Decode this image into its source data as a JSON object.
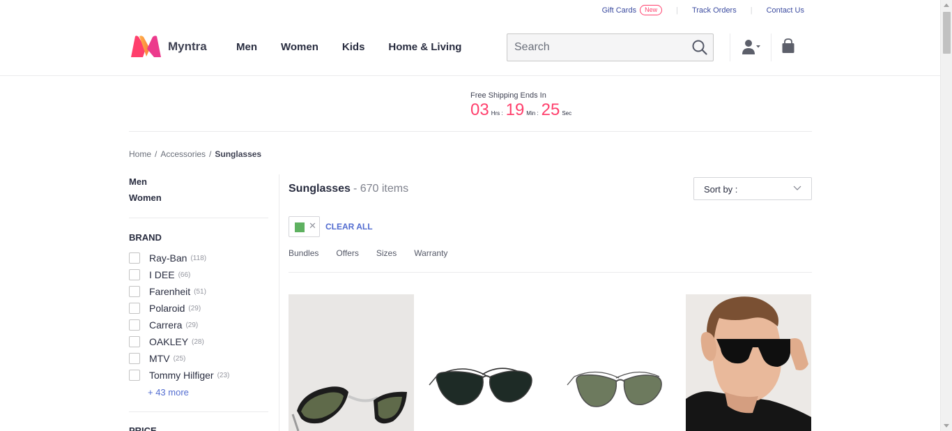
{
  "toplinks": {
    "gift_cards": "Gift Cards",
    "new_badge": "New",
    "track_orders": "Track Orders",
    "contact_us": "Contact Us"
  },
  "brand": {
    "name": "Myntra"
  },
  "nav": [
    "Men",
    "Women",
    "Kids",
    "Home & Living"
  ],
  "search": {
    "placeholder": "Search"
  },
  "banner": {
    "title": "Free Shipping Ends In",
    "hours": "03",
    "hours_unit": "Hrs :",
    "minutes": "19",
    "minutes_unit": "Min :",
    "seconds": "25",
    "seconds_unit": "Sec"
  },
  "breadcrumb": {
    "home": "Home",
    "sep": "/",
    "category": "Accessories",
    "current": "Sunglasses"
  },
  "sidebar": {
    "genders": [
      "Men",
      "Women"
    ],
    "brand_title": "BRAND",
    "brands": [
      {
        "name": "Ray-Ban",
        "count": "(118)"
      },
      {
        "name": "I DEE",
        "count": "(66)"
      },
      {
        "name": "Farenheit",
        "count": "(51)"
      },
      {
        "name": "Polaroid",
        "count": "(29)"
      },
      {
        "name": "Carrera",
        "count": "(29)"
      },
      {
        "name": "OAKLEY",
        "count": "(28)"
      },
      {
        "name": "MTV",
        "count": "(25)"
      },
      {
        "name": "Tommy Hilfiger",
        "count": "(23)"
      }
    ],
    "more": "+ 43 more",
    "price_title": "PRICE"
  },
  "main": {
    "title": "Sunglasses",
    "count": "- 670 items",
    "sort_label": "Sort by :",
    "clear_all": "CLEAR ALL",
    "filters": [
      "Bundles",
      "Offers",
      "Sizes",
      "Warranty"
    ]
  },
  "colors": {
    "accent": "#ff3f6c",
    "link": "#526cd0",
    "selected_swatch": "#5eb160"
  }
}
